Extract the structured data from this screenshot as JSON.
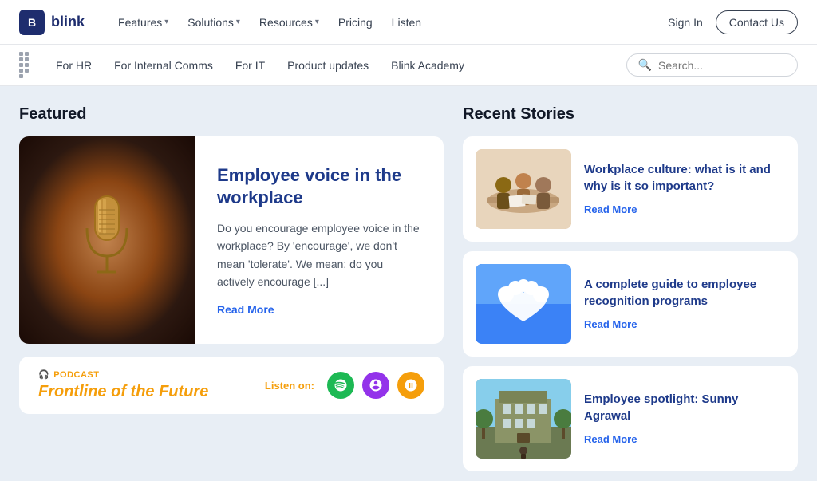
{
  "brand": {
    "logo_letter": "B",
    "logo_name": "blink"
  },
  "top_nav": {
    "items": [
      {
        "label": "Features",
        "has_dropdown": true
      },
      {
        "label": "Solutions",
        "has_dropdown": true
      },
      {
        "label": "Resources",
        "has_dropdown": true
      },
      {
        "label": "Pricing",
        "has_dropdown": false
      },
      {
        "label": "Listen",
        "has_dropdown": false
      }
    ],
    "sign_in": "Sign In",
    "contact_us": "Contact Us"
  },
  "secondary_nav": {
    "items": [
      {
        "label": "For HR"
      },
      {
        "label": "For Internal Comms"
      },
      {
        "label": "For IT"
      },
      {
        "label": "Product updates"
      },
      {
        "label": "Blink Academy"
      }
    ],
    "search_placeholder": "Search..."
  },
  "featured": {
    "section_title": "Featured",
    "card": {
      "title": "Employee voice in the workplace",
      "description": "Do you encourage employee voice in the workplace?  By 'encourage', we don't mean 'tolerate'. We mean: do you actively encourage [...]",
      "read_more": "Read More"
    }
  },
  "podcast": {
    "label": "PODCAST",
    "title": "Frontline of the Future",
    "listen_label": "Listen on:"
  },
  "recent_stories": {
    "section_title": "Recent Stories",
    "stories": [
      {
        "title": "Workplace culture: what is it and why is it so important?",
        "read_more": "Read More",
        "image_type": "workplace"
      },
      {
        "title": "A complete guide to employee recognition programs",
        "read_more": "Read More",
        "image_type": "cloud"
      },
      {
        "title": "Employee spotlight: Sunny Agrawal",
        "read_more": "Read More",
        "image_type": "building"
      }
    ]
  }
}
